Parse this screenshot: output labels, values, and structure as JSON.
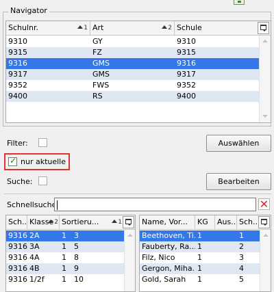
{
  "navigator": {
    "title": "Navigator",
    "columns": [
      {
        "label": "Schulnr.",
        "sort": "1"
      },
      {
        "label": "Art",
        "sort": "2"
      },
      {
        "label": "Schule",
        "sort": ""
      }
    ],
    "rows": [
      {
        "schulnr": "9310",
        "art": "GY",
        "schule": "9310"
      },
      {
        "schulnr": "9315",
        "art": "FZ",
        "schule": "9315"
      },
      {
        "schulnr": "9316",
        "art": "GMS",
        "schule": "9316"
      },
      {
        "schulnr": "9317",
        "art": "GMS",
        "schule": "9317"
      },
      {
        "schulnr": "9352",
        "art": "FWS",
        "schule": "9352"
      },
      {
        "schulnr": "9400",
        "art": "RS",
        "schule": "9400"
      }
    ]
  },
  "filter": {
    "filter_label": "Filter:",
    "auswaehlen_label": "Auswählen",
    "nur_aktuelle_label": "nur aktuelle",
    "nur_aktuelle_checked": "✓",
    "suche_label": "Suche:",
    "bearbeiten_label": "Bearbeiten"
  },
  "schnellsuche": {
    "label": "Schnellsuche",
    "value": ""
  },
  "klassen": {
    "columns": [
      {
        "label": "Sch...",
        "sort": ""
      },
      {
        "label": "Klasse",
        "sort": "2"
      },
      {
        "label": "Sortieru...",
        "sort": "1"
      }
    ],
    "rows": [
      {
        "sch": "9316",
        "klasse": "2A",
        "sort": "1",
        "num": "3"
      },
      {
        "sch": "9316",
        "klasse": "3A",
        "sort": "1",
        "num": "5"
      },
      {
        "sch": "9316",
        "klasse": "4A",
        "sort": "1",
        "num": "8"
      },
      {
        "sch": "9316",
        "klasse": "4B",
        "sort": "1",
        "num": "9"
      },
      {
        "sch": "9316",
        "klasse": "1/2f",
        "sort": "1",
        "num": "10"
      }
    ]
  },
  "schueler": {
    "columns": [
      {
        "label": "Name, Vor..."
      },
      {
        "label": "KG"
      },
      {
        "label": "Aus..."
      },
      {
        "label": "Sch..."
      }
    ],
    "rows": [
      {
        "name": "Beethoven, Ti...",
        "kg": "1",
        "aus": "",
        "sch": "1"
      },
      {
        "name": "Fauberty, Ra...",
        "kg": "1",
        "aus": "",
        "sch": "2"
      },
      {
        "name": "Filz, Nico",
        "kg": "1",
        "aus": "",
        "sch": "3"
      },
      {
        "name": "Gergon, Miha...",
        "kg": "1",
        "aus": "",
        "sch": "4"
      },
      {
        "name": "Gold, Sarah",
        "kg": "1",
        "aus": "",
        "sch": "5"
      }
    ]
  }
}
